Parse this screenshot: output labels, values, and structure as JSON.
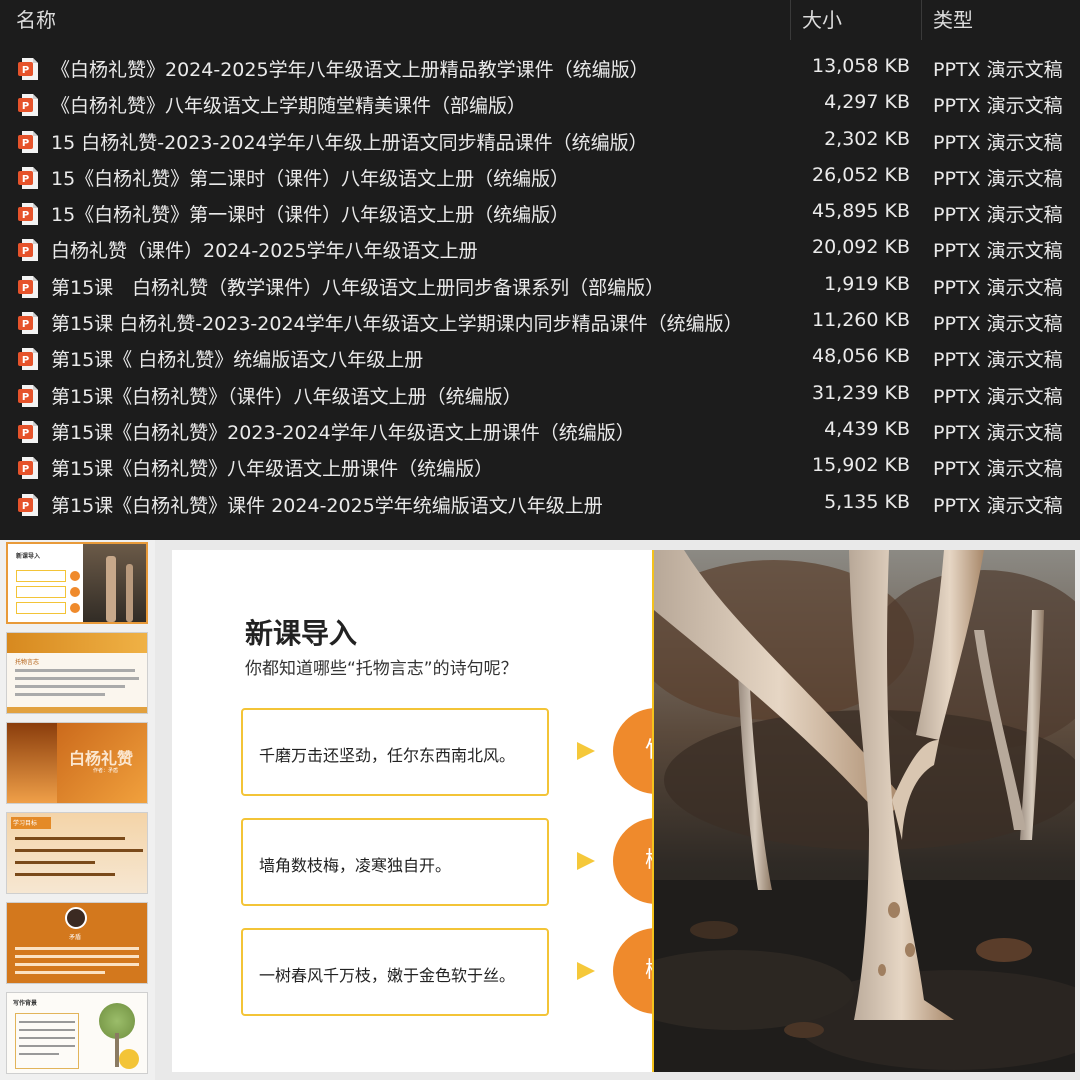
{
  "file_list": {
    "columns": {
      "name": "名称",
      "size": "大小",
      "type": "类型"
    },
    "files": [
      {
        "name": "《白杨礼赞》2024-2025学年八年级语文上册精品教学课件（统编版）",
        "size": "13,058 KB",
        "type": "PPTX 演示文稿"
      },
      {
        "name": "《白杨礼赞》八年级语文上学期随堂精美课件（部编版）",
        "size": "4,297 KB",
        "type": "PPTX 演示文稿"
      },
      {
        "name": "15 白杨礼赞-2023-2024学年八年级上册语文同步精品课件（统编版）",
        "size": "2,302 KB",
        "type": "PPTX 演示文稿"
      },
      {
        "name": "15《白杨礼赞》第二课时（课件）八年级语文上册（统编版）",
        "size": "26,052 KB",
        "type": "PPTX 演示文稿"
      },
      {
        "name": "15《白杨礼赞》第一课时（课件）八年级语文上册（统编版）",
        "size": "45,895 KB",
        "type": "PPTX 演示文稿"
      },
      {
        "name": "白杨礼赞（课件）2024-2025学年八年级语文上册",
        "size": "20,092 KB",
        "type": "PPTX 演示文稿"
      },
      {
        "name": "第15课　白杨礼赞（教学课件）八年级语文上册同步备课系列（部编版）",
        "size": "1,919 KB",
        "type": "PPTX 演示文稿"
      },
      {
        "name": "第15课 白杨礼赞-2023-2024学年八年级语文上学期课内同步精品课件（统编版）",
        "size": "11,260 KB",
        "type": "PPTX 演示文稿"
      },
      {
        "name": "第15课《 白杨礼赞》统编版语文八年级上册",
        "size": "48,056 KB",
        "type": "PPTX 演示文稿"
      },
      {
        "name": "第15课《白杨礼赞》（课件）八年级语文上册（统编版）",
        "size": "31,239 KB",
        "type": "PPTX 演示文稿"
      },
      {
        "name": "第15课《白杨礼赞》2023-2024学年八年级语文上册课件（统编版）",
        "size": "4,439 KB",
        "type": "PPTX 演示文稿"
      },
      {
        "name": "第15课《白杨礼赞》八年级语文上册课件（统编版）",
        "size": "15,902 KB",
        "type": "PPTX 演示文稿"
      },
      {
        "name": "第15课《白杨礼赞》课件 2024-2025学年统编版语文八年级上册",
        "size": "5,135 KB",
        "type": "PPTX 演示文稿"
      }
    ],
    "icon": "powerpoint-file-icon"
  },
  "slide": {
    "title": "新课导入",
    "subtitle": "你都知道哪些“托物言志”的诗句呢？",
    "poems": [
      {
        "text": "千磨万击还坚劲，任尔东西南北风。",
        "char": "竹"
      },
      {
        "text": "墙角数枝梅，凌寒独自开。",
        "char": "梅"
      },
      {
        "text": "一树春风千万枝，嫩于金色软于丝。",
        "char": "柳"
      }
    ],
    "accent_color": "#ef8a2c",
    "border_color": "#f3c437"
  },
  "thumbnails": [
    {
      "label": "新课导入",
      "active": true
    },
    {
      "label": "托物言志"
    },
    {
      "label": "白杨礼赞",
      "author": "作者：矛盾"
    },
    {
      "label": "学习目标"
    },
    {
      "label": "矛盾"
    },
    {
      "label": "写作背景"
    }
  ]
}
